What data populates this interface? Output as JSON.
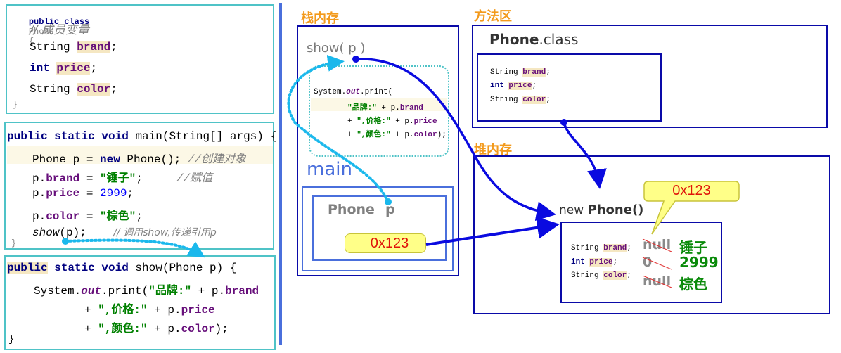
{
  "left": {
    "class_block": {
      "header": [
        "public class",
        "Phone",
        "{"
      ],
      "comment": "// 成员变量",
      "fields": [
        {
          "type": "String",
          "name": "brand"
        },
        {
          "type": "int",
          "name": "price"
        },
        {
          "type": "String",
          "name": "color"
        }
      ],
      "close": "}"
    },
    "main_block": {
      "signature": [
        "public static void",
        "main(String[] args) {"
      ],
      "lines": {
        "l1_a": "Phone p = ",
        "l1_new": "new",
        "l1_b": " Phone(); ",
        "l1_cmt": "//创建对象",
        "l2_a": "p.",
        "l2_f": "brand",
        "l2_b": " = ",
        "l2_s": "\"锤子\"",
        "l2_c": ";",
        "l2_cmt": "//赋值",
        "l3_a": "p.",
        "l3_f": "price",
        "l3_b": " = ",
        "l3_n": "2999",
        "l3_c": ";",
        "l4_a": "p.",
        "l4_f": "color",
        "l4_b": " = ",
        "l4_s": "\"棕色\"",
        "l4_c": ";",
        "l5_m": "show",
        "l5_b": "(p);",
        "l5_cmt": "// 调用show,传递引用p"
      },
      "close": "}"
    },
    "show_block": {
      "sig_public": "public",
      "sig_kw": " static void",
      "sig_rest": " show(Phone p) {",
      "l1_a": "System.",
      "l1_out": "out",
      "l1_b": ".print(",
      "l1_s": "\"品牌:\"",
      "l1_c": " + p.",
      "l1_f": "brand",
      "l2_a": "+ ",
      "l2_s": "\",价格:\"",
      "l2_c": " + p.",
      "l2_f": "price",
      "l3_a": "+ ",
      "l3_s": "\",颜色:\"",
      "l3_c": " + p.",
      "l3_f": "color",
      "l3_d": ");",
      "close": "}"
    }
  },
  "stack": {
    "title": "栈内存",
    "show_frame": "show( p )",
    "show_code": {
      "l1_a": "System.",
      "l1_out": "out",
      "l1_b": ".print(",
      "l2_s": "\"品牌:\"",
      "l2_c": " + p.",
      "l2_f": "brand",
      "l3_a": "+ ",
      "l3_s": "\",价格:\"",
      "l3_c": " + p.",
      "l3_f": "price",
      "l4_a": "+ ",
      "l4_s": "\",颜色:\"",
      "l4_c": " + p.",
      "l4_f": "color",
      "l4_d": ");"
    },
    "main_frame": "main",
    "var_type": "Phone",
    "var_name": "p",
    "var_value": "0x123"
  },
  "method_area": {
    "title": "方法区",
    "class_name_bold": "Phone",
    "class_name_ext": ".class",
    "fields": [
      {
        "type": "String",
        "name": "brand"
      },
      {
        "type": "int",
        "name": "price"
      },
      {
        "type": "String",
        "name": "color"
      }
    ]
  },
  "heap": {
    "title": "堆内存",
    "new_kw": "new",
    "new_cls": "Phone()",
    "address": "0x123",
    "fields": [
      {
        "type": "String",
        "name": "brand",
        "default": "null",
        "value": "锤子"
      },
      {
        "type": "int",
        "name": "price",
        "default": "0",
        "value": "2999"
      },
      {
        "type": "String",
        "name": "color",
        "default": "null",
        "value": "棕色"
      }
    ]
  },
  "colors": {
    "accent_orange": "#f39a1c",
    "navy": "#0a0aa8",
    "teal_border": "#4fc3c7",
    "dotted_cyan": "#1ab8ec",
    "address_red": "#e0140a",
    "value_green": "#0a8a0a"
  }
}
